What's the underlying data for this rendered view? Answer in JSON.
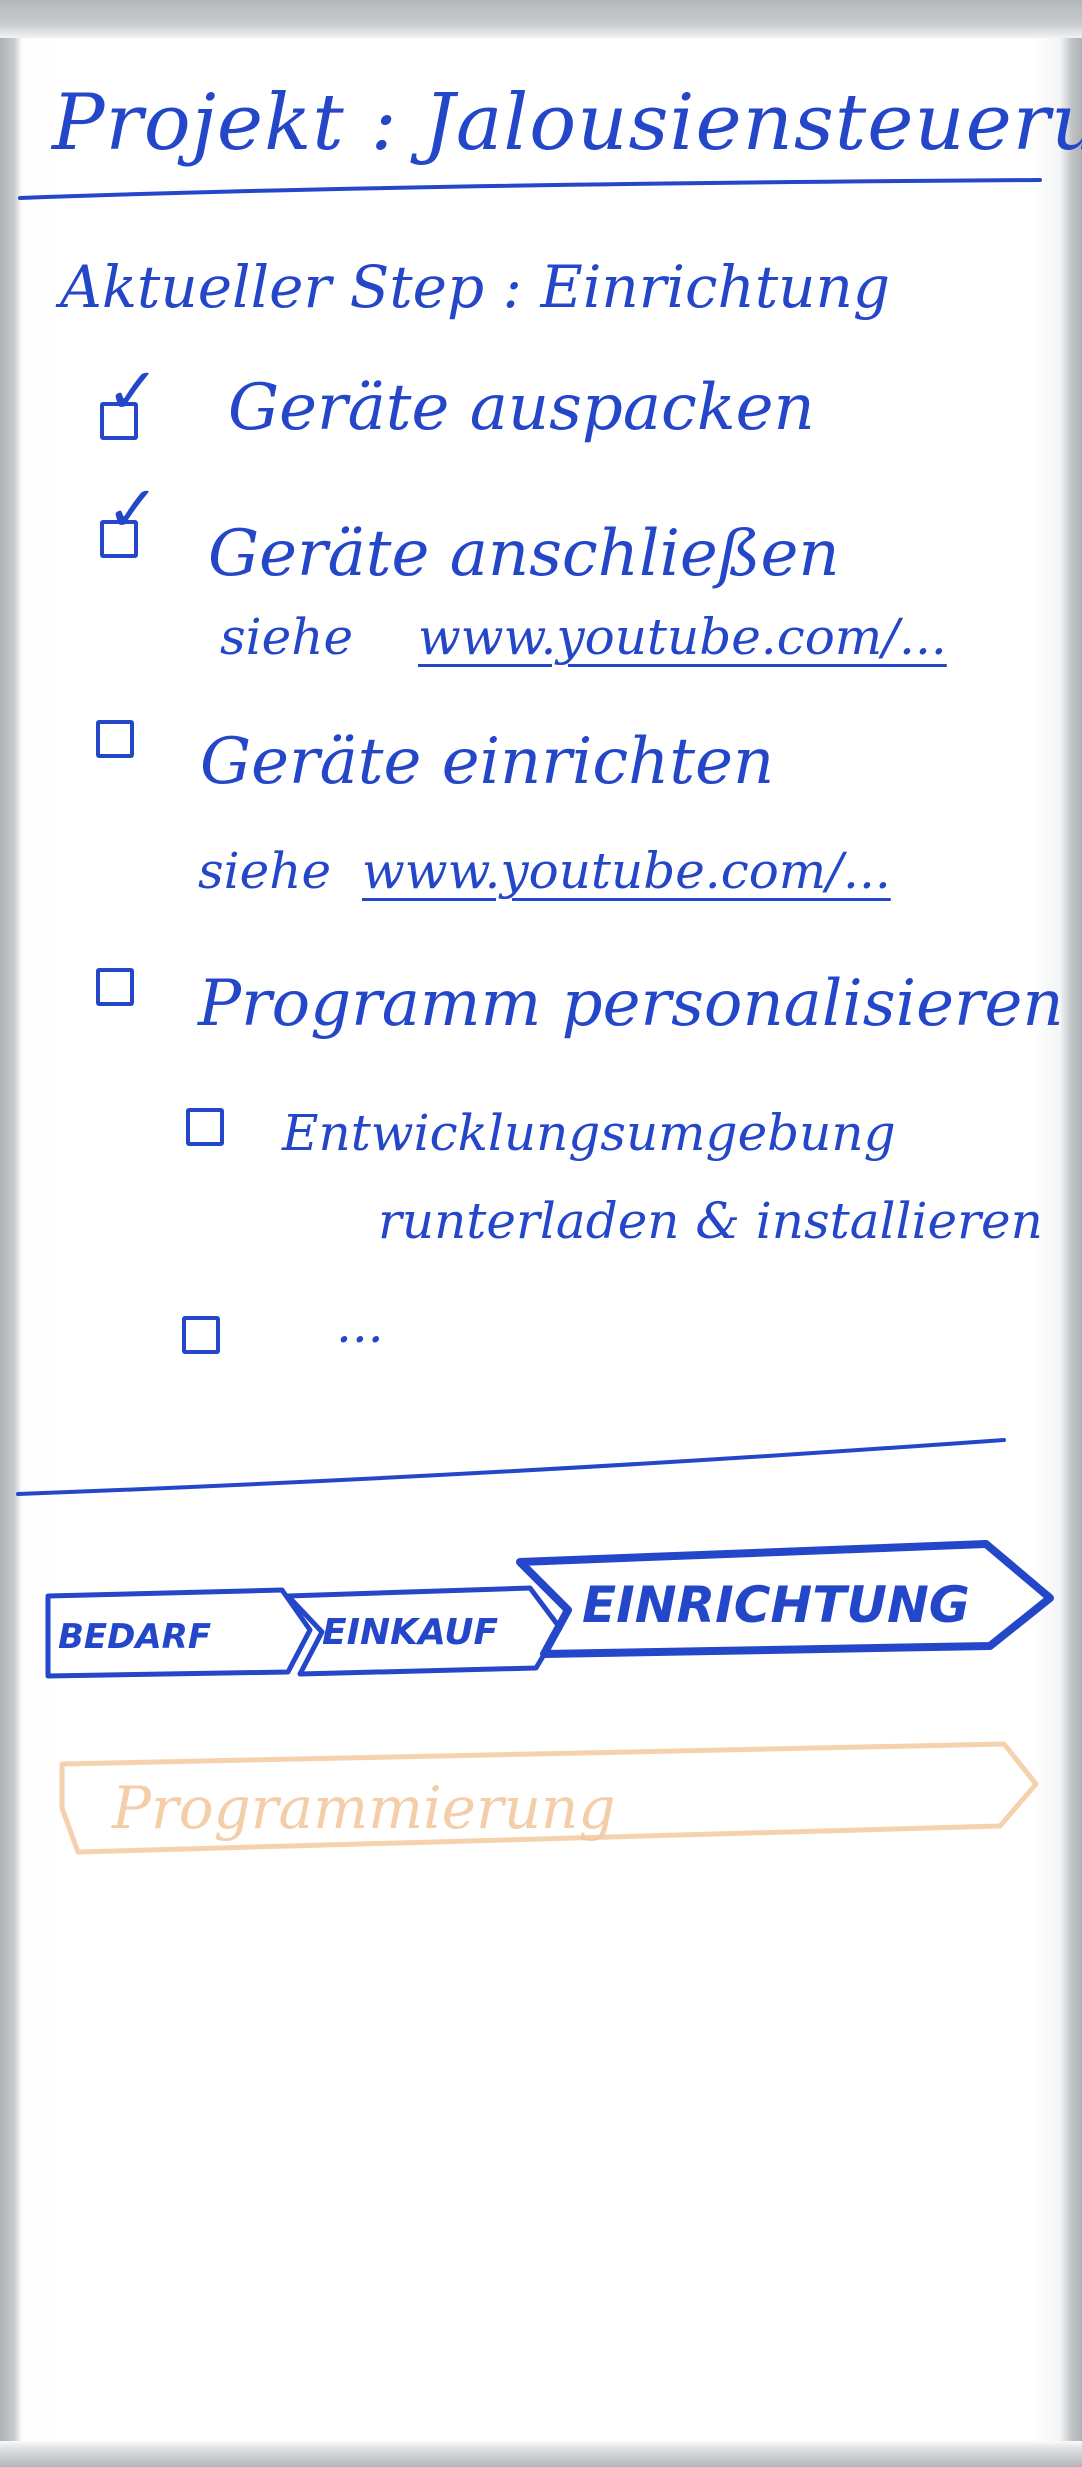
{
  "title": "Projekt : Jalousiensteuerung",
  "current_step": "Aktueller Step : Einrichtung",
  "tasks": [
    {
      "label": "Geräte auspacken",
      "checked": true
    },
    {
      "label": "Geräte anschließen",
      "checked": true,
      "note_prefix": "siehe",
      "note_link": "www.youtube.com/..."
    },
    {
      "label": "Geräte einrichten",
      "checked": false,
      "note_prefix": "siehe",
      "note_link": "www.youtube.com/..."
    },
    {
      "label": "Programm personalisieren",
      "checked": false
    },
    {
      "label": "Entwicklungsumgebung",
      "label_line2": "runterladen & installieren",
      "checked": false
    },
    {
      "label": "...",
      "checked": false
    }
  ],
  "stepper": {
    "steps": [
      "BEDARF",
      "EINKAUF",
      "EINRICHTUNG"
    ],
    "active": "EINRICHTUNG",
    "next_faded": "Programmierung"
  },
  "colors": {
    "ink": "#2446c8",
    "faded": "#f3c9a0",
    "paper": "#ffffff"
  }
}
